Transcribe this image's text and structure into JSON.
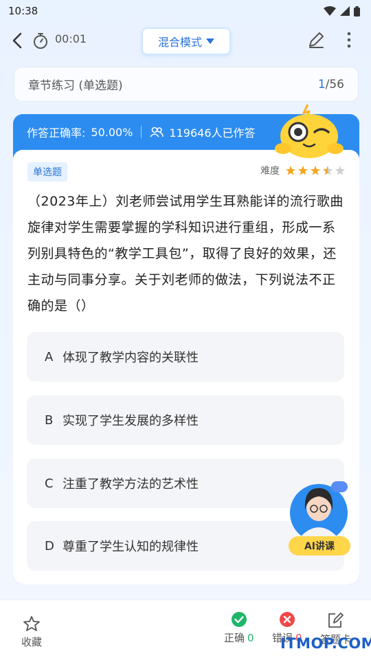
{
  "status_bar": {
    "time": "10:38"
  },
  "header": {
    "timer": "00:01",
    "mode_label": "混合模式"
  },
  "chapter": {
    "title": "章节练习 (单选题)",
    "current": "1",
    "total": "/56"
  },
  "stats": {
    "accuracy_label": "作答正确率:",
    "accuracy_value": "50.00%",
    "answered": "119646人已作答"
  },
  "question": {
    "type": "单选题",
    "difficulty_label": "难度",
    "difficulty_stars": 3.5,
    "text": "（2023年上）刘老师尝试用学生耳熟能详的流行歌曲旋律对学生需要掌握的学科知识进行重组，形成一系列别具特色的“教学工具包”，取得了良好的效果，还主动与同事分享。关于刘老师的做法，下列说法不正确的是（）",
    "options": [
      {
        "letter": "A",
        "text": "体现了教学内容的关联性"
      },
      {
        "letter": "B",
        "text": "实现了学生发展的多样性"
      },
      {
        "letter": "C",
        "text": "注重了教学方法的艺术性"
      },
      {
        "letter": "D",
        "text": "尊重了学生认知的规律性"
      }
    ]
  },
  "ai": {
    "label": "AI讲课"
  },
  "bottom": {
    "favorite": "收藏",
    "correct_label": "正确",
    "correct_count": "0",
    "wrong_label": "错误",
    "wrong_count": "0",
    "answer_card": "答题卡"
  },
  "watermark": "ITMOP.COM",
  "colors": {
    "accent": "#2d8cf0",
    "correct": "#1fb66a",
    "wrong": "#f04848",
    "star": "#f5a623"
  }
}
